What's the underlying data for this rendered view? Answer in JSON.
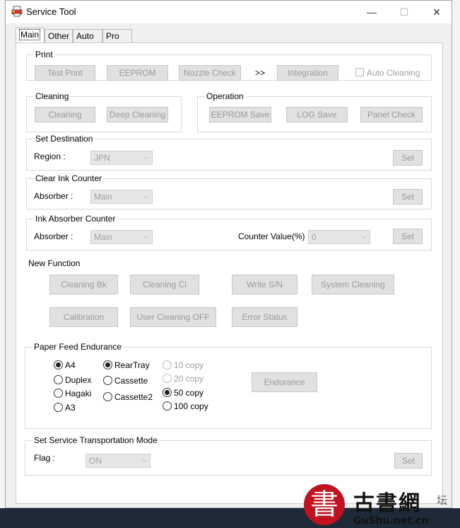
{
  "window": {
    "title": "Service Tool",
    "controls": {
      "minimize": "—",
      "maximize": "☐",
      "close": "✕"
    }
  },
  "tabs": [
    {
      "label": "Main",
      "active": true
    },
    {
      "label": "Other"
    },
    {
      "label": "Auto"
    },
    {
      "label": "Pro"
    }
  ],
  "print": {
    "label": "Print",
    "test_print": "Test Print",
    "eeprom": "EEPROM",
    "nozzle_check": "Nozzle Check",
    "arrow": ">>",
    "integration": "Integration",
    "auto_cleaning": "Auto Cleaning"
  },
  "cleaning": {
    "label": "Cleaning",
    "cleaning": "Cleaning",
    "deep_cleaning": "Deep Cleaning"
  },
  "operation": {
    "label": "Operation",
    "eeprom_save": "EEPROM Save",
    "log_save": "LOG Save",
    "panel_check": "Panel Check"
  },
  "set_destination": {
    "label": "Set Destination",
    "region_label": "Region :",
    "region_value": "JPN",
    "set": "Set"
  },
  "clear_ink_counter": {
    "label": "Clear Ink Counter",
    "absorber_label": "Absorber :",
    "absorber_value": "Main",
    "set": "Set"
  },
  "ink_absorber_counter": {
    "label": "Ink Absorber Counter",
    "absorber_label": "Absorber :",
    "absorber_value": "Main",
    "counter_label": "Counter Value(%) :",
    "counter_value": "0",
    "set": "Set"
  },
  "new_function": {
    "label": "New Function",
    "cleaning_bk": "Cleaning Bk",
    "cleaning_cl": "Cleaning Cl",
    "write_sn": "Write S/N",
    "system_cleaning": "System Cleaning",
    "calibration": "Calibration",
    "user_cleaning_off": "User Cleaning OFF",
    "error_status": "Error Status"
  },
  "paper_feed": {
    "label": "Paper Feed Endurance",
    "sizes": [
      "A4",
      "Duplex",
      "Hagaki",
      "A3"
    ],
    "sources": [
      "RearTray",
      "Cassette",
      "Cassette2"
    ],
    "copies": [
      "10 copy",
      "20 copy",
      "50 copy",
      "100 copy"
    ],
    "endurance": "Endurance"
  },
  "transport_mode": {
    "label": "Set Service Transportation Mode",
    "flag_label": "Flag :",
    "flag_value": "ON",
    "set": "Set"
  },
  "watermark": {
    "char": "書",
    "name": "古書網",
    "url": "GuShu.net.cn",
    "side": "坛"
  }
}
